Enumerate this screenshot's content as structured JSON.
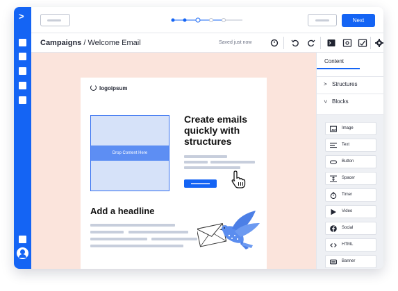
{
  "nav": {
    "rail_items": [
      "expand-icon",
      "menu-square-1",
      "menu-square-2",
      "menu-square-3",
      "menu-square-4",
      "menu-square-5",
      "menu-square-6"
    ],
    "accent": "#1464f4"
  },
  "header": {
    "progress_steps": 5,
    "progress_done": 3,
    "next_label": "Next"
  },
  "subbar": {
    "campaigns": "Campaigns",
    "separator": " / ",
    "email_name": "Welcome Email",
    "saved": "Saved just now"
  },
  "template": {
    "logo": "logoipsum",
    "drop_label": "Drop Content Here",
    "headline_1": "Create emails quickly with structures",
    "headline_2": "Add a headline"
  },
  "panel": {
    "tab": "Content",
    "structures": "Structures",
    "blocks_label": "Blocks",
    "blocks": [
      {
        "label": "Image",
        "icon": "image-icon"
      },
      {
        "label": "Text",
        "icon": "text-icon"
      },
      {
        "label": "Button",
        "icon": "button-icon"
      },
      {
        "label": "Spacer",
        "icon": "spacer-icon"
      },
      {
        "label": "Timer",
        "icon": "timer-icon"
      },
      {
        "label": "Video",
        "icon": "video-icon"
      },
      {
        "label": "Social",
        "icon": "facebook-icon"
      },
      {
        "label": "HTML",
        "icon": "code-icon"
      },
      {
        "label": "Banner",
        "icon": "banner-icon"
      }
    ]
  },
  "colors": {
    "canvas_bg": "#fbe4dc",
    "drop_fill": "#d6e2f9",
    "drop_band": "#5d8ef3"
  }
}
